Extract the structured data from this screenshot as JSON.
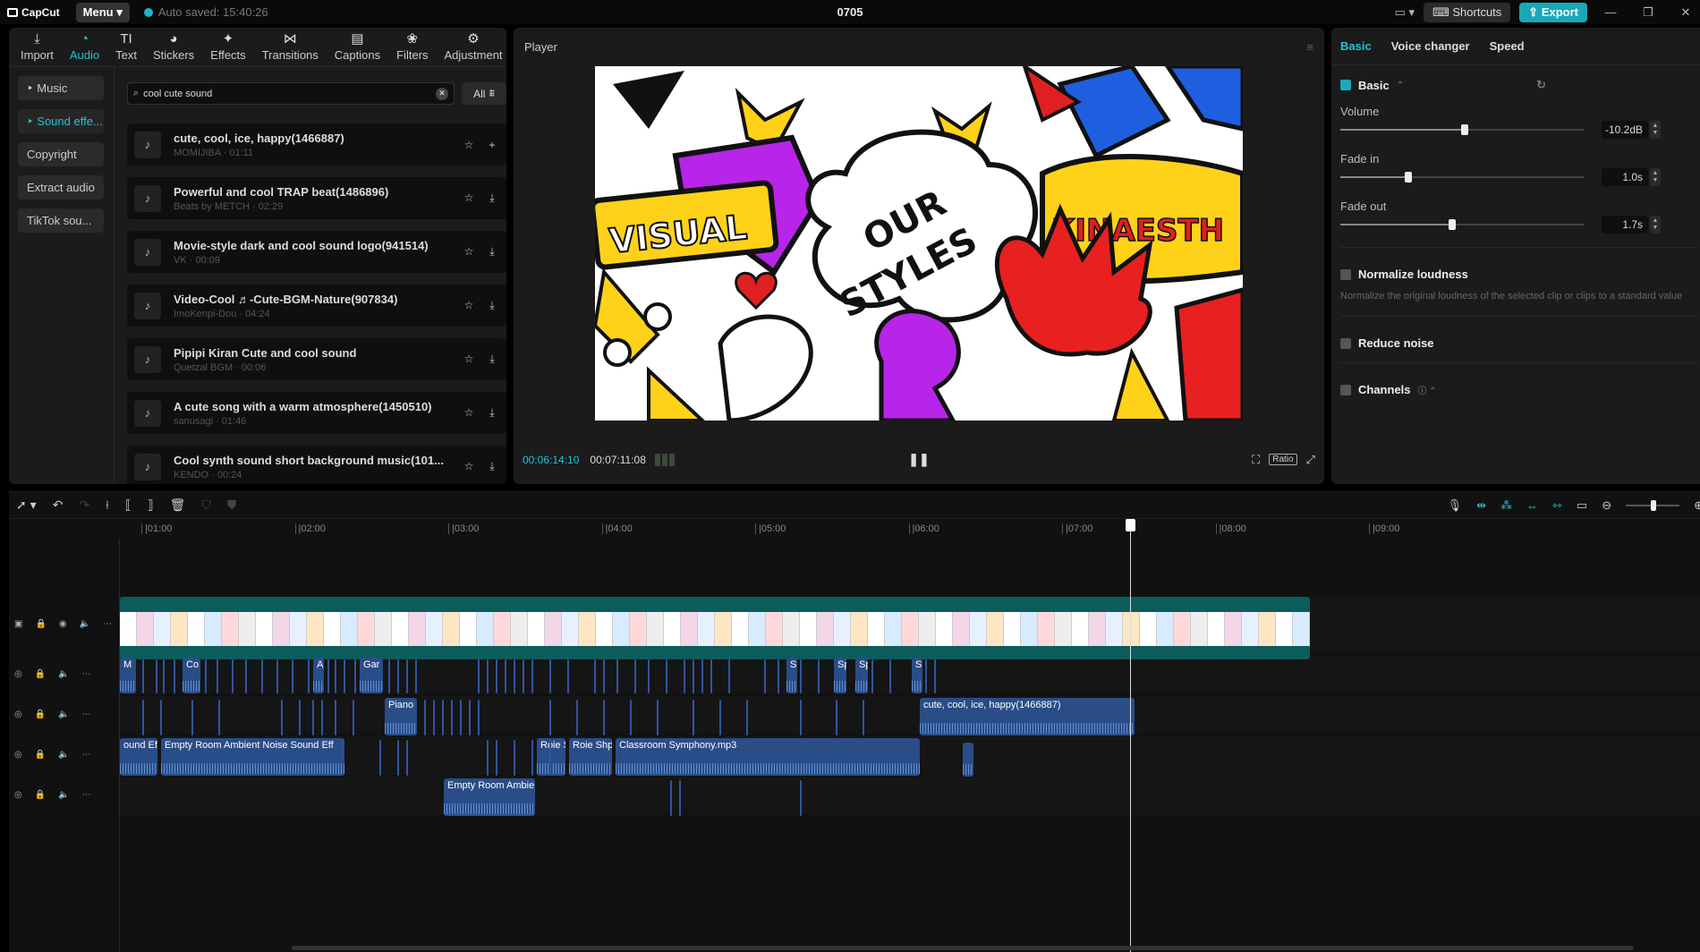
{
  "titlebar": {
    "app": "CapCut",
    "menu": "Menu",
    "autosave": "Auto saved: 15:40:26",
    "project": "0705",
    "shortcuts": "Shortcuts",
    "export": "Export"
  },
  "toolbar": [
    {
      "label": "Import",
      "icon": "import-icon",
      "glyph": "⤓"
    },
    {
      "label": "Audio",
      "icon": "audio-icon",
      "glyph": "◔",
      "active": true
    },
    {
      "label": "Text",
      "icon": "text-icon",
      "glyph": "TI"
    },
    {
      "label": "Stickers",
      "icon": "stickers-icon",
      "glyph": "◕"
    },
    {
      "label": "Effects",
      "icon": "effects-icon",
      "glyph": "✦"
    },
    {
      "label": "Transitions",
      "icon": "transitions-icon",
      "glyph": "⋈"
    },
    {
      "label": "Captions",
      "icon": "captions-icon",
      "glyph": "▤"
    },
    {
      "label": "Filters",
      "icon": "filters-icon",
      "glyph": "❀"
    },
    {
      "label": "Adjustment",
      "icon": "adjustment-icon",
      "glyph": "⚙"
    }
  ],
  "sidebar": [
    {
      "label": "‣ Music"
    },
    {
      "label": "‣ Sound effe...",
      "active": true
    },
    {
      "label": "Copyright"
    },
    {
      "label": "Extract audio"
    },
    {
      "label": "TikTok sou..."
    }
  ],
  "search": {
    "value": "cool cute sound",
    "filter": "All"
  },
  "sounds": [
    {
      "title": "cute, cool, ice, happy(1466887)",
      "meta": "MOMIJIBA · 01:11",
      "action": "+"
    },
    {
      "title": "Powerful and cool TRAP beat(1486896)",
      "meta": "Beats by METCH · 02:29",
      "action": "⤓"
    },
    {
      "title": "Movie-style dark and cool sound logo(941514)",
      "meta": "VK · 00:09",
      "action": "⤓"
    },
    {
      "title": "Video-Cool ♬-Cute-BGM-Nature(907834)",
      "meta": "ImoKenpi-Dou · 04:24",
      "action": "⤓"
    },
    {
      "title": "Pipipi Kiran Cute and cool sound",
      "meta": "Quetzal BGM · 00:06",
      "action": "⤓"
    },
    {
      "title": "A cute song with a warm atmosphere(1450510)",
      "meta": "sanusagi · 01:46",
      "action": "⤓"
    },
    {
      "title": "Cool synth sound short background music(101...",
      "meta": "KENDO · 00:24",
      "action": "⤓"
    }
  ],
  "player": {
    "title": "Player",
    "current": "00:06:14:10",
    "total": "00:07:11:08",
    "ratio": "Ratio",
    "art_text": [
      "VISUAL",
      "OUR",
      "STYLES",
      "KINAESTH"
    ]
  },
  "right": {
    "tabs": [
      "Basic",
      "Voice changer",
      "Speed"
    ],
    "basic": "Basic",
    "volume": {
      "label": "Volume",
      "value": "-10.2dB",
      "level": 0.51
    },
    "fadein": {
      "label": "Fade in",
      "value": "1.0s",
      "level": 0.28
    },
    "fadeout": {
      "label": "Fade out",
      "value": "1.7s",
      "level": 0.46
    },
    "normalize": "Normalize loudness",
    "normalize_desc": "Normalize the original loudness of the selected clip or clips to a standard value",
    "reduce": "Reduce noise",
    "channels": "Channels"
  },
  "ruler": [
    "|01:00",
    "|02:00",
    "|03:00",
    "|04:00",
    "|05:00",
    "|06:00",
    "|07:00",
    "|08:00",
    "|09:00"
  ],
  "clips": {
    "a1": [
      "M",
      "Co",
      "A",
      "Gar",
      "Sp",
      "Sp",
      "Sp",
      "Sp"
    ],
    "a2": [
      "Piano",
      "cute, cool, ice, happy(1466887)"
    ],
    "a3": [
      "ound Eff",
      "Empty Room Ambient Noise Sound Eff",
      "Roie S",
      "Roie Shp",
      "Classroom Symphony.mp3"
    ],
    "a4": [
      "Empty Room Ambie"
    ]
  }
}
